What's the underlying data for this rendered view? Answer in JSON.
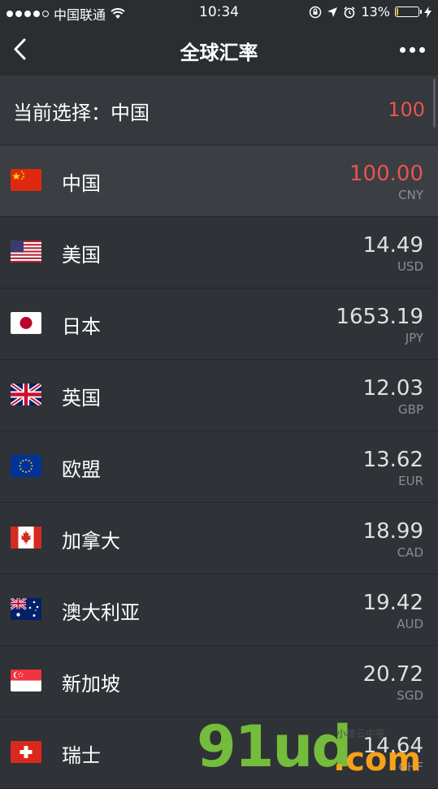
{
  "status_bar": {
    "carrier": "中国联通",
    "time": "10:34",
    "battery": "13%",
    "battery_level": 0.13
  },
  "nav": {
    "title": "全球汇率"
  },
  "selection": {
    "label": "当前选择：中国",
    "amount": "100"
  },
  "currencies": [
    {
      "name": "中国",
      "value": "100.00",
      "code": "CNY",
      "flag": "china-flag-icon"
    },
    {
      "name": "美国",
      "value": "14.49",
      "code": "USD",
      "flag": "usa-flag-icon"
    },
    {
      "name": "日本",
      "value": "1653.19",
      "code": "JPY",
      "flag": "japan-flag-icon"
    },
    {
      "name": "英国",
      "value": "12.03",
      "code": "GBP",
      "flag": "uk-flag-icon"
    },
    {
      "name": "欧盟",
      "value": "13.62",
      "code": "EUR",
      "flag": "eu-flag-icon"
    },
    {
      "name": "加拿大",
      "value": "18.99",
      "code": "CAD",
      "flag": "canada-flag-icon"
    },
    {
      "name": "澳大利亚",
      "value": "19.42",
      "code": "AUD",
      "flag": "australia-flag-icon"
    },
    {
      "name": "新加坡",
      "value": "20.72",
      "code": "SGD",
      "flag": "singapore-flag-icon"
    },
    {
      "name": "瑞士",
      "value": "14.64",
      "code": "CHF",
      "flag": "switzerland-flag-icon"
    }
  ],
  "watermark": {
    "main": "91ud",
    "suffix": ".com",
    "small": "小楼云中夜"
  },
  "colors": {
    "background": "#2f3236",
    "selected_row": "#3b3e43",
    "accent_red": "#e85450"
  }
}
